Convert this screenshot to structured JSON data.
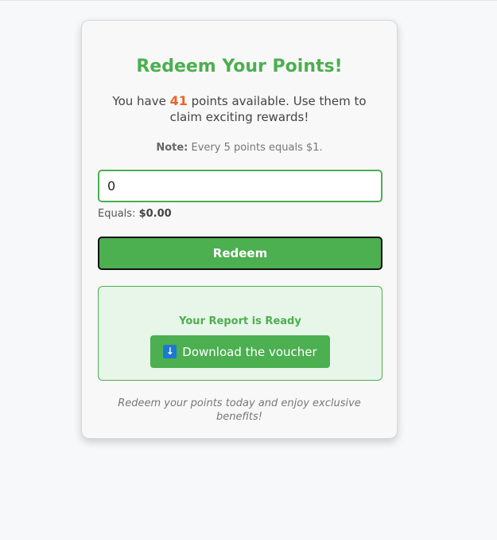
{
  "card": {
    "title": "Redeem Your Points!",
    "intro": {
      "prefix": "You have ",
      "points": "41",
      "suffix": " points available. Use them to claim exciting rewards!"
    },
    "note": {
      "label": "Note:",
      "text": " Every 5 points equals $1."
    },
    "input": {
      "value": "0"
    },
    "equals": {
      "label": "Equals: ",
      "amount": "$0.00"
    },
    "redeem_button": {
      "label": "Redeem"
    },
    "report": {
      "title": "Your Report is Ready",
      "download_icon": "download-arrow-icon",
      "download_icon_glyph": "↓",
      "download_label": "Download the voucher"
    },
    "footer": "Redeem your points today and enjoy exclusive benefits!"
  },
  "colors": {
    "accent": "#4caf50",
    "points": "#e8642c",
    "report_bg": "#e8f5e9",
    "icon_bg": "#1e78d2"
  }
}
